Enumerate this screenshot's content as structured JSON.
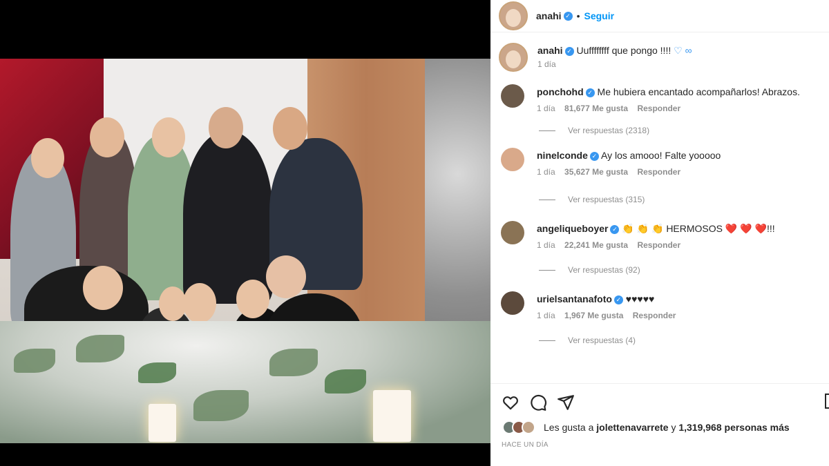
{
  "post": {
    "author": "anahi",
    "follow_label": "Seguir",
    "separator": "•",
    "caption_text": "Uuffffffff que pongo !!!!",
    "caption_emoji": "♡ ∞",
    "caption_time": "1 día"
  },
  "comments": [
    {
      "user": "ponchohd",
      "text": "Me hubiera encantado acompañarlos! Abrazos.",
      "time": "1 día",
      "likes": "81,677 Me gusta",
      "reply_label": "Responder",
      "view_replies": "Ver respuestas (2318)",
      "avatar_color": "#6b5a4a"
    },
    {
      "user": "ninelconde",
      "text": "Ay los amooo! Falte yooooo",
      "time": "1 día",
      "likes": "35,627 Me gusta",
      "reply_label": "Responder",
      "view_replies": "Ver respuestas (315)",
      "avatar_color": "#d9a98a"
    },
    {
      "user": "angeliqueboyer",
      "text": "👏 👏 👏 HERMOSOS ❤️ ❤️ ❤️!!!",
      "time": "1 día",
      "likes": "22,241 Me gusta",
      "reply_label": "Responder",
      "view_replies": "Ver respuestas (92)",
      "avatar_color": "#8a7355"
    },
    {
      "user": "urielsantanafoto",
      "text": "♥♥♥♥♥",
      "time": "1 día",
      "likes": "1,967 Me gusta",
      "reply_label": "Responder",
      "view_replies": "Ver respuestas (4)",
      "avatar_color": "#5c4a3c"
    }
  ],
  "footer": {
    "likes_prefix": "Les gusta a",
    "likes_user": "jolettenavarrete",
    "likes_mid": "y",
    "likes_count": "1,319,968 personas más",
    "timestamp": "HACE UN DÍA"
  },
  "colors": {
    "verified": "#3897f0",
    "follow": "#0095f6",
    "secondary_text": "#8e8e8e"
  },
  "icons": {
    "like": "heart-icon",
    "comment": "comment-icon",
    "share": "share-icon",
    "save": "bookmark-icon"
  }
}
